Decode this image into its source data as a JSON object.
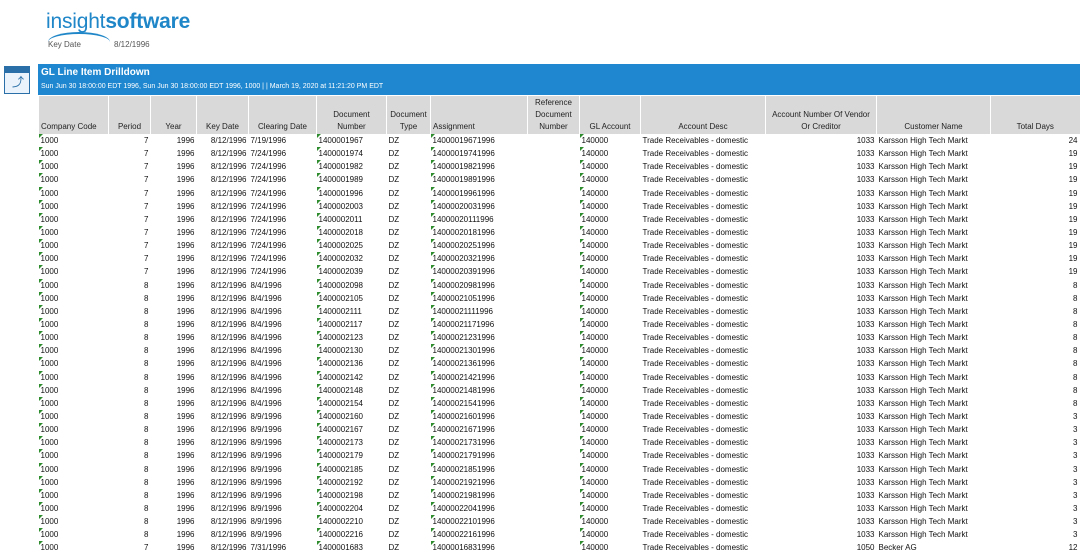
{
  "brand": {
    "prefix": "insight",
    "suffix": "software"
  },
  "key_date": {
    "label": "Key Date",
    "value": "8/12/1996"
  },
  "report": {
    "title": "GL Line Item Drilldown",
    "subtitle": "Sun Jun 30 18:00:00 EDT 1996, Sun Jun 30 18:00:00 EDT 1996, 1000 | | March 19, 2020 at 11:21:20 PM EDT"
  },
  "table": {
    "columns": [
      "Company Code",
      "Period",
      "Year",
      "Key Date",
      "Clearing Date",
      "Document Number",
      "Document Type",
      "Assignment",
      "Reference Document Number",
      "GL Account",
      "Account Desc",
      "Account Number Of Vendor Or Creditor",
      "Customer Name",
      "Total Days"
    ],
    "rows": [
      [
        "1000",
        "7",
        "1996",
        "8/12/1996",
        "7/19/1996",
        "1400001967",
        "DZ",
        "14000019671996",
        "",
        "140000",
        "Trade Receivables - domestic",
        "1033",
        "Karsson High Tech Markt",
        "24"
      ],
      [
        "1000",
        "7",
        "1996",
        "8/12/1996",
        "7/24/1996",
        "1400001974",
        "DZ",
        "14000019741996",
        "",
        "140000",
        "Trade Receivables - domestic",
        "1033",
        "Karsson High Tech Markt",
        "19"
      ],
      [
        "1000",
        "7",
        "1996",
        "8/12/1996",
        "7/24/1996",
        "1400001982",
        "DZ",
        "14000019821996",
        "",
        "140000",
        "Trade Receivables - domestic",
        "1033",
        "Karsson High Tech Markt",
        "19"
      ],
      [
        "1000",
        "7",
        "1996",
        "8/12/1996",
        "7/24/1996",
        "1400001989",
        "DZ",
        "14000019891996",
        "",
        "140000",
        "Trade Receivables - domestic",
        "1033",
        "Karsson High Tech Markt",
        "19"
      ],
      [
        "1000",
        "7",
        "1996",
        "8/12/1996",
        "7/24/1996",
        "1400001996",
        "DZ",
        "14000019961996",
        "",
        "140000",
        "Trade Receivables - domestic",
        "1033",
        "Karsson High Tech Markt",
        "19"
      ],
      [
        "1000",
        "7",
        "1996",
        "8/12/1996",
        "7/24/1996",
        "1400002003",
        "DZ",
        "14000020031996",
        "",
        "140000",
        "Trade Receivables - domestic",
        "1033",
        "Karsson High Tech Markt",
        "19"
      ],
      [
        "1000",
        "7",
        "1996",
        "8/12/1996",
        "7/24/1996",
        "1400002011",
        "DZ",
        "14000020111996",
        "",
        "140000",
        "Trade Receivables - domestic",
        "1033",
        "Karsson High Tech Markt",
        "19"
      ],
      [
        "1000",
        "7",
        "1996",
        "8/12/1996",
        "7/24/1996",
        "1400002018",
        "DZ",
        "14000020181996",
        "",
        "140000",
        "Trade Receivables - domestic",
        "1033",
        "Karsson High Tech Markt",
        "19"
      ],
      [
        "1000",
        "7",
        "1996",
        "8/12/1996",
        "7/24/1996",
        "1400002025",
        "DZ",
        "14000020251996",
        "",
        "140000",
        "Trade Receivables - domestic",
        "1033",
        "Karsson High Tech Markt",
        "19"
      ],
      [
        "1000",
        "7",
        "1996",
        "8/12/1996",
        "7/24/1996",
        "1400002032",
        "DZ",
        "14000020321996",
        "",
        "140000",
        "Trade Receivables - domestic",
        "1033",
        "Karsson High Tech Markt",
        "19"
      ],
      [
        "1000",
        "7",
        "1996",
        "8/12/1996",
        "7/24/1996",
        "1400002039",
        "DZ",
        "14000020391996",
        "",
        "140000",
        "Trade Receivables - domestic",
        "1033",
        "Karsson High Tech Markt",
        "19"
      ],
      [
        "1000",
        "8",
        "1996",
        "8/12/1996",
        "8/4/1996",
        "1400002098",
        "DZ",
        "14000020981996",
        "",
        "140000",
        "Trade Receivables - domestic",
        "1033",
        "Karsson High Tech Markt",
        "8"
      ],
      [
        "1000",
        "8",
        "1996",
        "8/12/1996",
        "8/4/1996",
        "1400002105",
        "DZ",
        "14000021051996",
        "",
        "140000",
        "Trade Receivables - domestic",
        "1033",
        "Karsson High Tech Markt",
        "8"
      ],
      [
        "1000",
        "8",
        "1996",
        "8/12/1996",
        "8/4/1996",
        "1400002111",
        "DZ",
        "14000021111996",
        "",
        "140000",
        "Trade Receivables - domestic",
        "1033",
        "Karsson High Tech Markt",
        "8"
      ],
      [
        "1000",
        "8",
        "1996",
        "8/12/1996",
        "8/4/1996",
        "1400002117",
        "DZ",
        "14000021171996",
        "",
        "140000",
        "Trade Receivables - domestic",
        "1033",
        "Karsson High Tech Markt",
        "8"
      ],
      [
        "1000",
        "8",
        "1996",
        "8/12/1996",
        "8/4/1996",
        "1400002123",
        "DZ",
        "14000021231996",
        "",
        "140000",
        "Trade Receivables - domestic",
        "1033",
        "Karsson High Tech Markt",
        "8"
      ],
      [
        "1000",
        "8",
        "1996",
        "8/12/1996",
        "8/4/1996",
        "1400002130",
        "DZ",
        "14000021301996",
        "",
        "140000",
        "Trade Receivables - domestic",
        "1033",
        "Karsson High Tech Markt",
        "8"
      ],
      [
        "1000",
        "8",
        "1996",
        "8/12/1996",
        "8/4/1996",
        "1400002136",
        "DZ",
        "14000021361996",
        "",
        "140000",
        "Trade Receivables - domestic",
        "1033",
        "Karsson High Tech Markt",
        "8"
      ],
      [
        "1000",
        "8",
        "1996",
        "8/12/1996",
        "8/4/1996",
        "1400002142",
        "DZ",
        "14000021421996",
        "",
        "140000",
        "Trade Receivables - domestic",
        "1033",
        "Karsson High Tech Markt",
        "8"
      ],
      [
        "1000",
        "8",
        "1996",
        "8/12/1996",
        "8/4/1996",
        "1400002148",
        "DZ",
        "14000021481996",
        "",
        "140000",
        "Trade Receivables - domestic",
        "1033",
        "Karsson High Tech Markt",
        "8"
      ],
      [
        "1000",
        "8",
        "1996",
        "8/12/1996",
        "8/4/1996",
        "1400002154",
        "DZ",
        "14000021541996",
        "",
        "140000",
        "Trade Receivables - domestic",
        "1033",
        "Karsson High Tech Markt",
        "8"
      ],
      [
        "1000",
        "8",
        "1996",
        "8/12/1996",
        "8/9/1996",
        "1400002160",
        "DZ",
        "14000021601996",
        "",
        "140000",
        "Trade Receivables - domestic",
        "1033",
        "Karsson High Tech Markt",
        "3"
      ],
      [
        "1000",
        "8",
        "1996",
        "8/12/1996",
        "8/9/1996",
        "1400002167",
        "DZ",
        "14000021671996",
        "",
        "140000",
        "Trade Receivables - domestic",
        "1033",
        "Karsson High Tech Markt",
        "3"
      ],
      [
        "1000",
        "8",
        "1996",
        "8/12/1996",
        "8/9/1996",
        "1400002173",
        "DZ",
        "14000021731996",
        "",
        "140000",
        "Trade Receivables - domestic",
        "1033",
        "Karsson High Tech Markt",
        "3"
      ],
      [
        "1000",
        "8",
        "1996",
        "8/12/1996",
        "8/9/1996",
        "1400002179",
        "DZ",
        "14000021791996",
        "",
        "140000",
        "Trade Receivables - domestic",
        "1033",
        "Karsson High Tech Markt",
        "3"
      ],
      [
        "1000",
        "8",
        "1996",
        "8/12/1996",
        "8/9/1996",
        "1400002185",
        "DZ",
        "14000021851996",
        "",
        "140000",
        "Trade Receivables - domestic",
        "1033",
        "Karsson High Tech Markt",
        "3"
      ],
      [
        "1000",
        "8",
        "1996",
        "8/12/1996",
        "8/9/1996",
        "1400002192",
        "DZ",
        "14000021921996",
        "",
        "140000",
        "Trade Receivables - domestic",
        "1033",
        "Karsson High Tech Markt",
        "3"
      ],
      [
        "1000",
        "8",
        "1996",
        "8/12/1996",
        "8/9/1996",
        "1400002198",
        "DZ",
        "14000021981996",
        "",
        "140000",
        "Trade Receivables - domestic",
        "1033",
        "Karsson High Tech Markt",
        "3"
      ],
      [
        "1000",
        "8",
        "1996",
        "8/12/1996",
        "8/9/1996",
        "1400002204",
        "DZ",
        "14000022041996",
        "",
        "140000",
        "Trade Receivables - domestic",
        "1033",
        "Karsson High Tech Markt",
        "3"
      ],
      [
        "1000",
        "8",
        "1996",
        "8/12/1996",
        "8/9/1996",
        "1400002210",
        "DZ",
        "14000022101996",
        "",
        "140000",
        "Trade Receivables - domestic",
        "1033",
        "Karsson High Tech Markt",
        "3"
      ],
      [
        "1000",
        "8",
        "1996",
        "8/12/1996",
        "8/9/1996",
        "1400002216",
        "DZ",
        "14000022161996",
        "",
        "140000",
        "Trade Receivables - domestic",
        "1033",
        "Karsson High Tech Markt",
        "3"
      ],
      [
        "1000",
        "7",
        "1996",
        "8/12/1996",
        "7/31/1996",
        "1400001683",
        "DZ",
        "14000016831996",
        "",
        "140000",
        "Trade Receivables - domestic",
        "1050",
        "Becker AG",
        "12"
      ]
    ]
  },
  "icons": {
    "report": "report-refresh-icon"
  },
  "colors": {
    "brand": "#1f86c8",
    "title_bar": "#1f87cf",
    "header_bg": "#d9d9d9",
    "cell_marker": "#2e8b2e"
  }
}
